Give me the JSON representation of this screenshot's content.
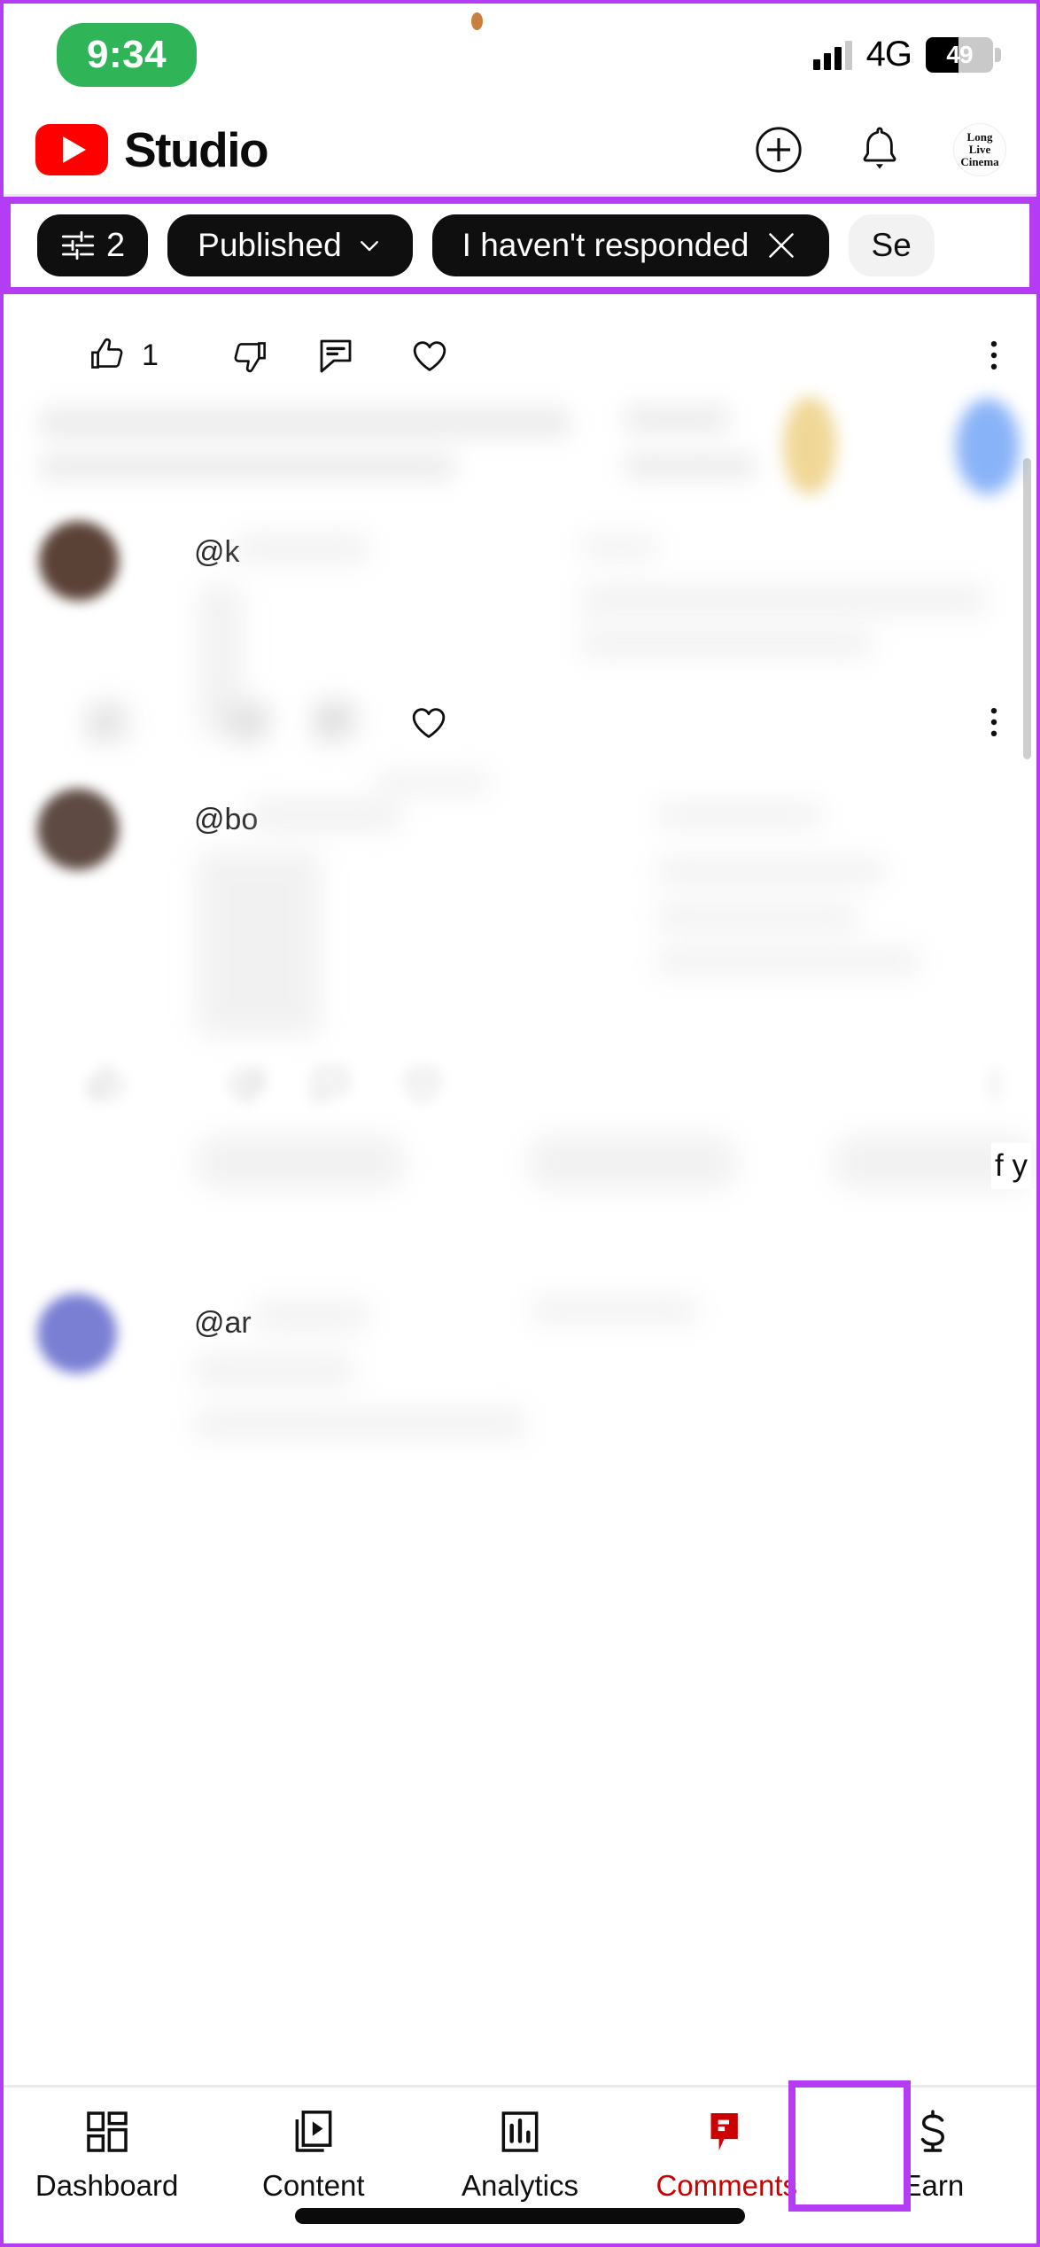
{
  "status_bar": {
    "time": "9:34",
    "network_type": "4G",
    "battery_percent": "49",
    "icons": [
      "signal-bars-icon",
      "battery-icon",
      "camera-dot"
    ]
  },
  "app_header": {
    "brand": "Studio",
    "logo_icon": "youtube-play-icon",
    "brand_color": "#ff0000",
    "actions": [
      {
        "name": "create-button",
        "icon": "plus-circle-icon"
      },
      {
        "name": "notifications-button",
        "icon": "bell-icon"
      }
    ],
    "avatar": {
      "line1": "Long",
      "line2": "Live",
      "line3": "Cinema",
      "icon": "channel-avatar"
    }
  },
  "filter_bar": {
    "highlight_color": "#b43cf5",
    "chips": [
      {
        "label": "2",
        "icon": "filter-sliders-icon",
        "type": "filter-count",
        "active": true
      },
      {
        "label": "Published",
        "icon": "chevron-down-icon",
        "type": "dropdown",
        "active": true
      },
      {
        "label": "I haven't responded",
        "icon": "close-icon",
        "type": "removable",
        "active": true
      },
      {
        "label": "Se",
        "icon": "",
        "type": "ghost-partial",
        "active": false
      }
    ]
  },
  "comment_list": {
    "top_actions": {
      "like_count": "1",
      "icons": [
        "thumb-up-icon",
        "thumb-down-icon",
        "reply-icon",
        "heart-icon",
        "more-vertical-icon"
      ]
    },
    "comments": [
      {
        "handle": "@k",
        "redacted": true,
        "actions": {
          "icons": [
            "thumb-up-icon",
            "thumb-down-icon",
            "reply-icon",
            "heart-icon",
            "more-vertical-icon"
          ]
        }
      },
      {
        "handle": "@bo",
        "redacted": true,
        "actions": {
          "icons": [
            "thumb-up-icon",
            "thumb-down-icon",
            "reply-icon",
            "heart-icon",
            "more-vertical-icon"
          ]
        }
      },
      {
        "handle": "@ar",
        "redacted": true
      }
    ],
    "edge_text": "f y"
  },
  "bottom_nav": {
    "active_color": "#cc0000",
    "highlight_color": "#b43cf5",
    "items": [
      {
        "label": "Dashboard",
        "icon": "dashboard-grid-icon",
        "active": false
      },
      {
        "label": "Content",
        "icon": "video-play-icon",
        "active": false
      },
      {
        "label": "Analytics",
        "icon": "bar-chart-icon",
        "active": false
      },
      {
        "label": "Comments",
        "icon": "comment-bubble-icon",
        "active": true
      },
      {
        "label": "Earn",
        "icon": "dollar-sign-icon",
        "active": false
      }
    ]
  }
}
